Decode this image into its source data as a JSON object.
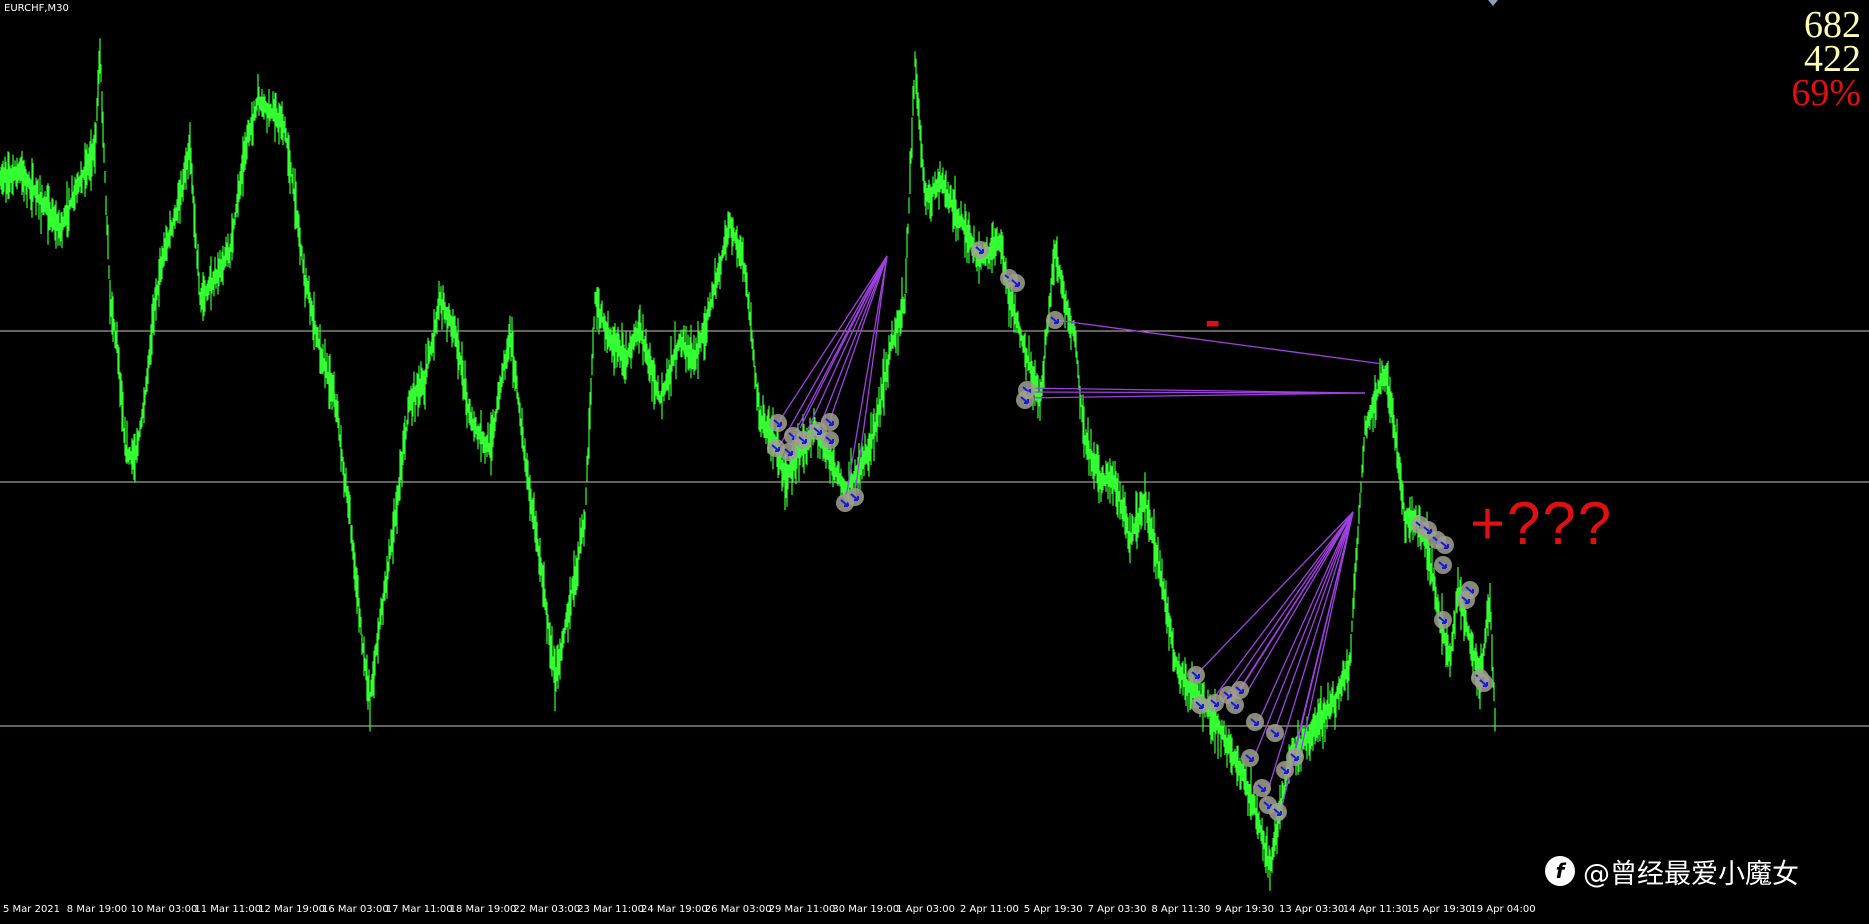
{
  "window": {
    "symbol_title": "EURCHF,M30"
  },
  "stats": {
    "line1": "682",
    "line2": "422",
    "line3": "69%"
  },
  "annotations": {
    "minus": "-",
    "plus": "+???"
  },
  "time_axis": {
    "labels": [
      "5 Mar 2021",
      "8 Mar 19:00",
      "10 Mar 03:00",
      "11 Mar 11:00",
      "12 Mar 19:00",
      "16 Mar 03:00",
      "17 Mar 11:00",
      "18 Mar 19:00",
      "22 Mar 03:00",
      "23 Mar 11:00",
      "24 Mar 19:00",
      "26 Mar 03:00",
      "29 Mar 11:00",
      "30 Mar 19:00",
      "1 Apr 03:00",
      "2 Apr 11:00",
      "5 Apr 19:30",
      "7 Apr 03:30",
      "8 Apr 11:30",
      "9 Apr 19:30",
      "13 Apr 03:30",
      "14 Apr 11:30",
      "15 Apr 19:30",
      "19 Apr 04:00"
    ]
  },
  "watermark": {
    "logo": "f",
    "text": "@曾经最爱小魔女"
  },
  "colors": {
    "background": "#000000",
    "price_line": "#33ff33",
    "level_line": "#c8c8b4",
    "trade_line": "#a040e0",
    "trade_marker_ring": "#a0a090",
    "trade_marker_core": "#1a1adc",
    "annotation": "#e01010",
    "stats_yellow": "#ffffb4"
  },
  "icons": {
    "scroll_marker": "triangle-down-icon",
    "trade_marker": "trade-arrow-icon"
  }
}
